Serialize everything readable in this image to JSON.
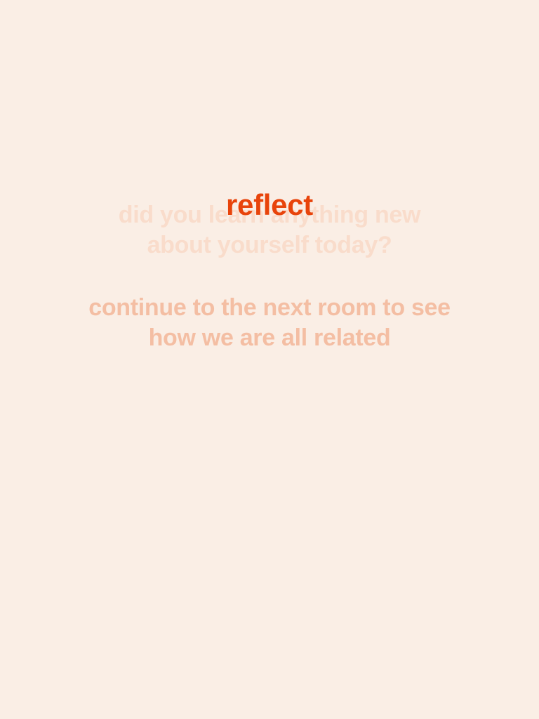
{
  "screen": {
    "title": "reflect",
    "question": {
      "lines": [
        "did you learn anything new",
        "about yourself today?"
      ]
    },
    "instruction": {
      "lines": [
        "continue to the next room to see",
        "how we are all related"
      ]
    }
  },
  "colors": {
    "background": "#FAEEE5",
    "title": "#E8440B",
    "question": "#F9DCCB",
    "instruction": "#F4BEA3"
  }
}
